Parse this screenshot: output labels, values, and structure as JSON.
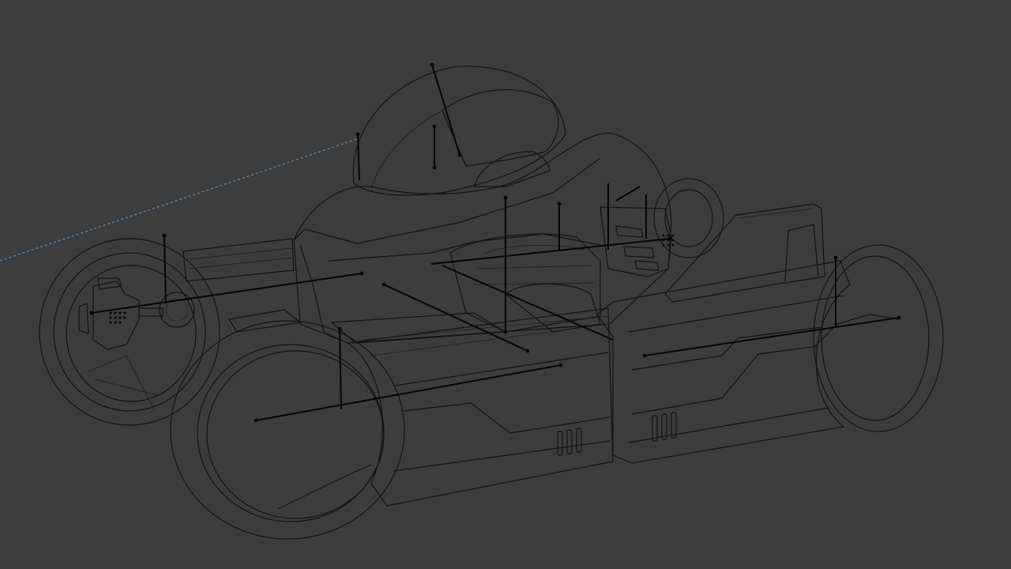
{
  "viewport": {
    "background_color": "#3d3d3d",
    "wire_color": "#121212",
    "relation_line_color": "#5a94c8",
    "display_mode": "wireframe"
  }
}
